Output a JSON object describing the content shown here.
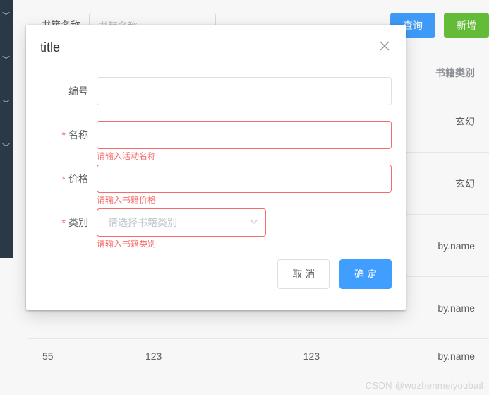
{
  "search": {
    "label": "书籍名称",
    "placeholder": "书籍名称",
    "query_btn": "查询",
    "add_btn": "新增"
  },
  "table": {
    "header_category": "书籍类别",
    "rows": [
      {
        "id": "",
        "price": "",
        "category": "玄幻"
      },
      {
        "id": "",
        "price": "",
        "category": "玄幻"
      },
      {
        "id": "",
        "price": "",
        "category": "by.name"
      },
      {
        "id": "",
        "price": "",
        "category": "by.name"
      },
      {
        "id": "55",
        "price": "123",
        "price2": "123",
        "category": "by.name"
      }
    ]
  },
  "sidebar_chevrons": [
    14,
    76,
    138,
    200
  ],
  "dialog": {
    "title": "title",
    "fields": {
      "id": {
        "label": "编号",
        "value": "",
        "required": false
      },
      "name": {
        "label": "名称",
        "value": "",
        "required": true,
        "error": "请输入活动名称"
      },
      "price": {
        "label": "价格",
        "value": "",
        "required": true,
        "error": "请输入书籍价格"
      },
      "category": {
        "label": "类别",
        "placeholder": "请选择书籍类别",
        "required": true,
        "error": "请输入书籍类别"
      }
    },
    "footer": {
      "cancel": "取 消",
      "confirm": "确 定"
    }
  },
  "watermark": "CSDN @wozhenmeiyoubail"
}
